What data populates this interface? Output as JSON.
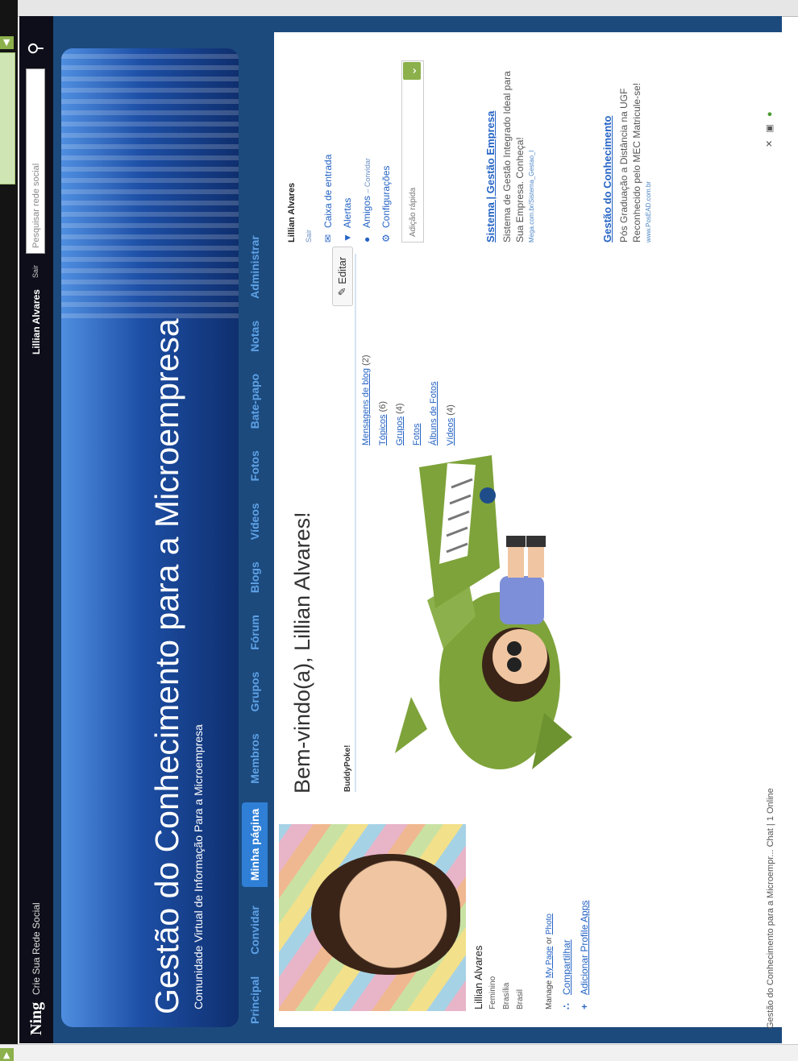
{
  "ning_bar": {
    "logo": "Ning",
    "create_link": "Crie Sua Rede Social",
    "user_name": "Lillian Alvares",
    "logout": "Sair",
    "search_placeholder": "Pesquisar rede social"
  },
  "header": {
    "title": "Gestão do Conhecimento para a Microempresa",
    "subtitle": "Comunidade Virtual de Informação Para a Microempresa"
  },
  "nav": {
    "items": [
      "Principal",
      "Convidar",
      "Minha página",
      "Membros",
      "Grupos",
      "Fórum",
      "Blogs",
      "Vídeos",
      "Fotos",
      "Bate-papo",
      "Notas",
      "Administrar"
    ],
    "active": "Minha página"
  },
  "profile": {
    "name": "Lillian Alvares",
    "gender": "Feminino",
    "city": "Brasília",
    "country": "Brasil",
    "manage_prefix": "Manage",
    "manage_page": "My Page",
    "manage_or": "or",
    "manage_photo": "Photo",
    "share": "Compartilhar",
    "add_apps": "Adicionar Profile Apps"
  },
  "welcome": {
    "heading": "Bem-vindo(a), Lillian Alvares!",
    "app_name": "BuddyPoke!",
    "edit_button": "Editar"
  },
  "my_stuff": [
    {
      "label": "Mensagens de blog",
      "count": "(2)"
    },
    {
      "label": "Tópicos",
      "count": "(6)"
    },
    {
      "label": "Grupos",
      "count": "(4)"
    },
    {
      "label": "Fotos",
      "count": ""
    },
    {
      "label": "Álbuns de Fotos",
      "count": ""
    },
    {
      "label": "Vídeos",
      "count": "(4)"
    }
  ],
  "sidebar": {
    "user_name": "Lillian Alvares",
    "logout": "Sair",
    "inbox": "Caixa de entrada",
    "alerts": "Alertas",
    "friends": "Amigos",
    "invite": "– Convidar",
    "settings": "Configurações",
    "quick_add_placeholder": "Adição rápida"
  },
  "ads": [
    {
      "title": "Sistema | Gestão Empresa",
      "body": "Sistema de Gestão Integrado Ideal para Sua Empresa. Conheça!",
      "url": "Mega.com.br/Sistema_Gestao_I"
    },
    {
      "title": "Gestão do Conhecimento",
      "body": "Pós Graduação a Distância na UGF Reconhecido pelo MEC Matricule-se!",
      "url": "www.PosEAD.com.br"
    }
  ],
  "chat_bar": {
    "text": "Gestão do Conhecimento para a Microempr... Chat | 1 Online"
  }
}
